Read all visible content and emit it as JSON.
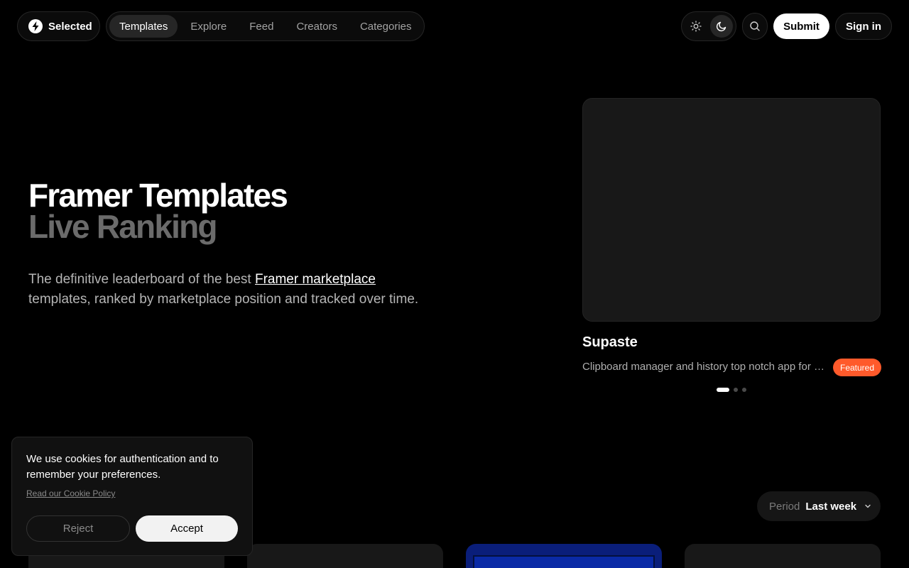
{
  "brand": {
    "name": "Selected",
    "icon": "bolt-logo-icon"
  },
  "nav": {
    "items": [
      {
        "label": "Templates",
        "active": true
      },
      {
        "label": "Explore"
      },
      {
        "label": "Feed"
      },
      {
        "label": "Creators"
      },
      {
        "label": "Categories"
      }
    ]
  },
  "header": {
    "theme_light_icon": "sun-icon",
    "theme_dark_icon": "moon-icon",
    "search_icon": "search-icon",
    "submit_label": "Submit",
    "signin_label": "Sign in"
  },
  "hero": {
    "title": "Framer Templates",
    "subtitle": "Live Ranking",
    "description_before": "The definitive leaderboard of the best ",
    "description_link": "Framer marketplace",
    "description_after": " templates, ranked by marketplace position and tracked over time."
  },
  "featured": {
    "title": "Supaste",
    "description": "Clipboard manager and history top notch app for Mac",
    "badge": "Featured",
    "badge_color": "#ff5a2b",
    "slides": 3,
    "active_slide": 1
  },
  "period": {
    "label": "Period",
    "value": "Last week"
  },
  "cookie": {
    "text": "We use cookies for authentication and to remember your preferences.",
    "policy_link": "Read our Cookie Policy",
    "reject_label": "Reject",
    "accept_label": "Accept"
  }
}
